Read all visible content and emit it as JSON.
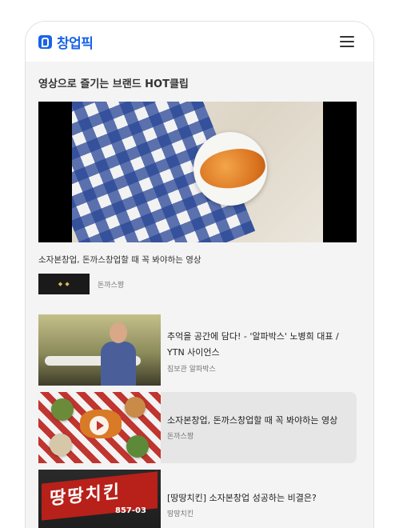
{
  "header": {
    "logo_text": "창업픽",
    "brand_color": "#1a63e8"
  },
  "section": {
    "title": "영상으로 즐기는 브랜드 HOT클립"
  },
  "featured": {
    "caption": "소자본창업, 돈까스창업할 때 꼭 봐야하는 영상",
    "channel_name": "돈까스짱"
  },
  "videos": [
    {
      "title": "추억을 공간에 담다! - '알파박스' 노병희 대표 / YTN 사이언스",
      "source": "짐보관 알파박스"
    },
    {
      "title": "소자본창업, 돈까스창업할 때 꼭 봐야하는 영상",
      "source": "돈까스짱"
    },
    {
      "title": "[땅땅치킨] 소자본창업 성공하는 비결은?",
      "source": "땅땅치킨"
    }
  ]
}
